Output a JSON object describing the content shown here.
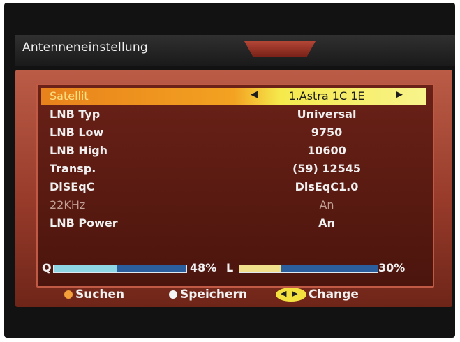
{
  "screen": {
    "title": "Antenneneinstellung"
  },
  "settings": [
    {
      "label": "Satellit",
      "value": "1.Astra 1C 1E",
      "state": "selected"
    },
    {
      "label": "LNB Typ",
      "value": "Universal",
      "state": "normal"
    },
    {
      "label": "LNB Low",
      "value": "9750",
      "state": "normal"
    },
    {
      "label": "LNB High",
      "value": "10600",
      "state": "normal"
    },
    {
      "label": "Transp.",
      "value": "(59) 12545",
      "state": "normal"
    },
    {
      "label": "DiSEqC",
      "value": "DisEqC1.0",
      "state": "normal"
    },
    {
      "label": "22KHz",
      "value": "An",
      "state": "disabled"
    },
    {
      "label": "LNB Power",
      "value": "An",
      "state": "normal"
    }
  ],
  "signal": {
    "quality_label": "Q",
    "quality_value": "48%",
    "quality_fraction": 0.48,
    "level_label": "L",
    "level_value": "30%",
    "level_fraction": 0.3
  },
  "footer": {
    "search_label": "Suchen",
    "save_label": "Speichern",
    "change_label": "Change"
  },
  "colors": {
    "quality_fill": "#8fd6e4",
    "level_fill": "#f0e08c",
    "search_dot": "#f3a03a",
    "save_dot": "#f5f5f5",
    "change_key": "#f3e140"
  },
  "icons": {
    "selector_left": "arrow-left-icon",
    "selector_right": "arrow-right-icon",
    "search_key": "orange-key-icon",
    "save_key": "white-key-icon",
    "change_key": "left-right-key-icon"
  }
}
